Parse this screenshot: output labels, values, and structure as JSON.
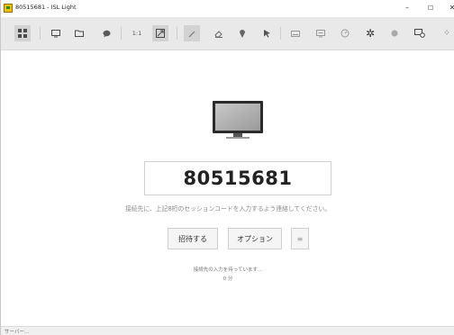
{
  "window": {
    "title": "80515681 - ISL Light",
    "minimize": "–",
    "maximize": "☐",
    "close": "✕"
  },
  "toolbar": {
    "items": [
      {
        "name": "grid-view-icon",
        "icon": "grid",
        "active": true
      },
      {
        "name": "chat-monitor-icon",
        "icon": "monitor"
      },
      {
        "name": "folder-icon",
        "icon": "folder"
      },
      {
        "name": "chat-bubble-icon",
        "icon": "bubble"
      },
      {
        "name": "zoom-1to1-button",
        "label": "1:1"
      },
      {
        "name": "fit-screen-icon",
        "icon": "fit",
        "active": true
      },
      {
        "name": "pen-icon",
        "icon": "pen",
        "active": true
      },
      {
        "name": "eraser-icon",
        "icon": "eraser"
      },
      {
        "name": "pin-icon",
        "icon": "pin"
      },
      {
        "name": "pointer-icon",
        "icon": "pointer"
      },
      {
        "name": "keyboard-icon",
        "icon": "keyboard"
      },
      {
        "name": "screen-icon",
        "icon": "screen"
      },
      {
        "name": "timer-icon",
        "icon": "timer"
      },
      {
        "name": "tools-icon",
        "icon": "tools"
      },
      {
        "name": "record-icon",
        "icon": "record"
      },
      {
        "name": "settings-screen-icon",
        "icon": "settings-screen"
      },
      {
        "name": "more-icon",
        "icon": "more"
      }
    ]
  },
  "main": {
    "session_code": "80515681",
    "instruction": "接続先に、上記8桁のセッションコードを入力するよう連絡してください。",
    "invite_label": "招待する",
    "options_label": "オプション",
    "menu_label": "≡",
    "waiting_text": "接続先の入力を待っています...",
    "elapsed_text": "0 分"
  },
  "statusbar": {
    "text": "サーバー..."
  }
}
